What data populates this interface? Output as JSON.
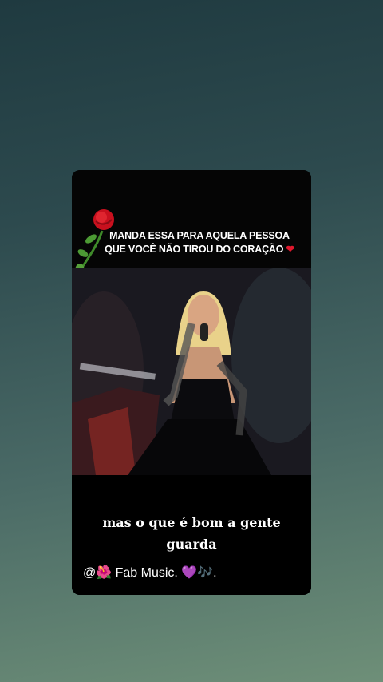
{
  "story": {
    "caption_line1": "MANDA ESSA PARA AQUELA  PESSOA",
    "caption_line2": "QUE VOCÊ NÃO  TIROU DO CORAÇÃO",
    "caption_emoji": "❤",
    "lyric_line1": "mas o que é bom a gente",
    "lyric_line2": "guarda",
    "credit_prefix": "@",
    "credit_emoji1": "🌺",
    "credit_text": " Fab Music. ",
    "credit_emoji2": "💜",
    "credit_emoji3": "🎶",
    "credit_suffix": ".",
    "rose_icon": "rose-icon"
  }
}
